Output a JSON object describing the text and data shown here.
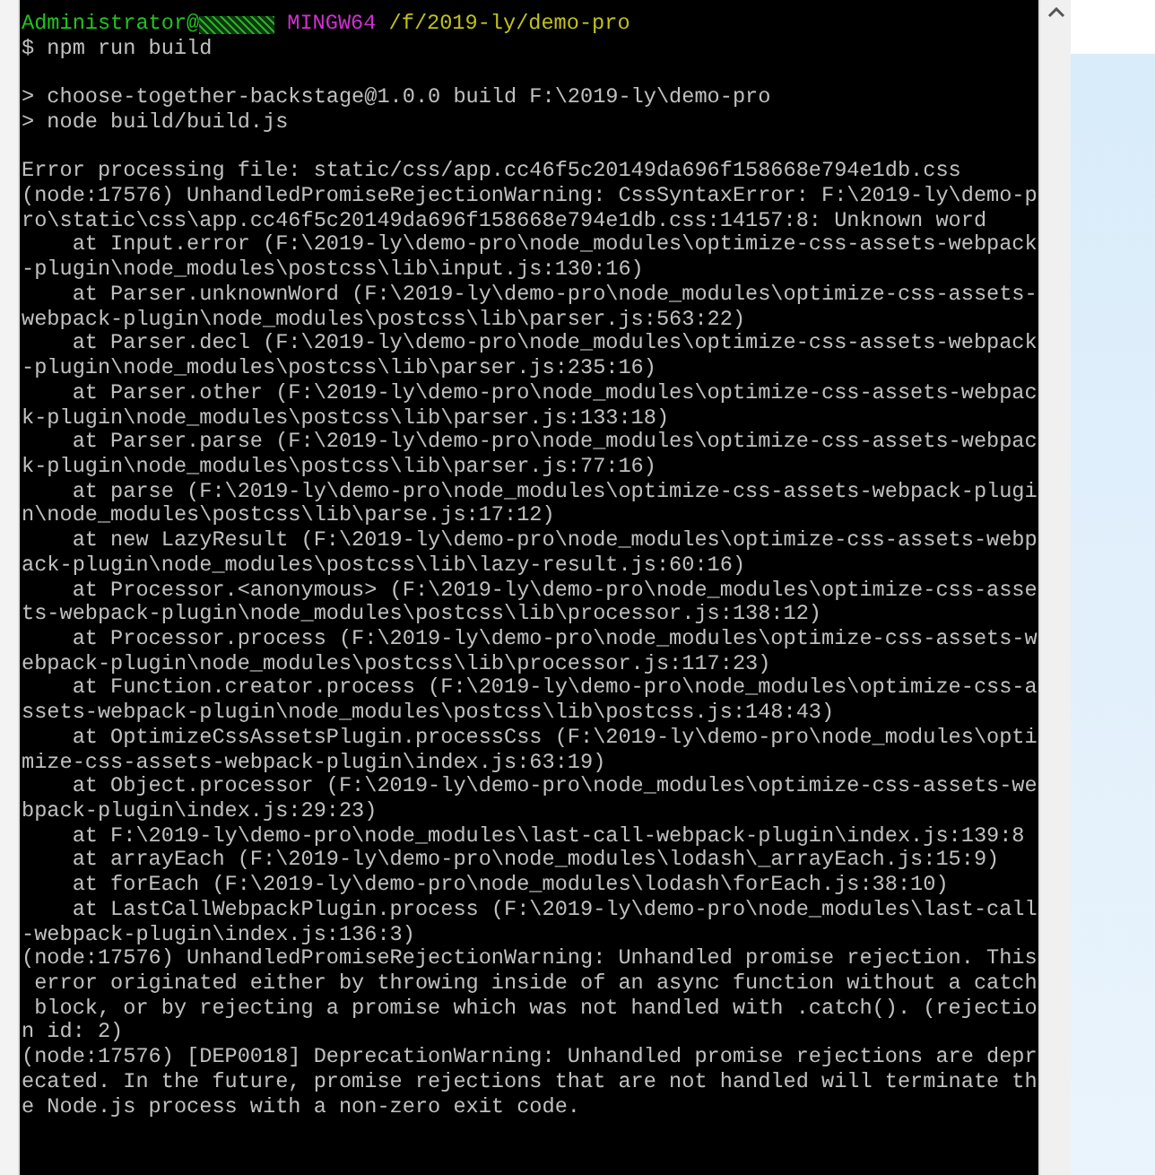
{
  "prompt": {
    "user": "Administrator@",
    "shell": "MINGW64",
    "path": "/f/2019-ly/demo-pro"
  },
  "command": "$ npm run build",
  "output_blocks": [
    [
      "> choose-together-backstage@1.0.0 build F:\\2019-ly\\demo-pro",
      "> node build/build.js"
    ],
    [
      "Error processing file: static/css/app.cc46f5c20149da696f158668e794e1db.css",
      "(node:17576) UnhandledPromiseRejectionWarning: CssSyntaxError: F:\\2019-ly\\demo-p",
      "ro\\static\\css\\app.cc46f5c20149da696f158668e794e1db.css:14157:8: Unknown word",
      "    at Input.error (F:\\2019-ly\\demo-pro\\node_modules\\optimize-css-assets-webpack",
      "-plugin\\node_modules\\postcss\\lib\\input.js:130:16)",
      "    at Parser.unknownWord (F:\\2019-ly\\demo-pro\\node_modules\\optimize-css-assets-",
      "webpack-plugin\\node_modules\\postcss\\lib\\parser.js:563:22)",
      "    at Parser.decl (F:\\2019-ly\\demo-pro\\node_modules\\optimize-css-assets-webpack",
      "-plugin\\node_modules\\postcss\\lib\\parser.js:235:16)",
      "    at Parser.other (F:\\2019-ly\\demo-pro\\node_modules\\optimize-css-assets-webpac",
      "k-plugin\\node_modules\\postcss\\lib\\parser.js:133:18)",
      "    at Parser.parse (F:\\2019-ly\\demo-pro\\node_modules\\optimize-css-assets-webpac",
      "k-plugin\\node_modules\\postcss\\lib\\parser.js:77:16)",
      "    at parse (F:\\2019-ly\\demo-pro\\node_modules\\optimize-css-assets-webpack-plugi",
      "n\\node_modules\\postcss\\lib\\parse.js:17:12)",
      "    at new LazyResult (F:\\2019-ly\\demo-pro\\node_modules\\optimize-css-assets-webp",
      "ack-plugin\\node_modules\\postcss\\lib\\lazy-result.js:60:16)",
      "    at Processor.<anonymous> (F:\\2019-ly\\demo-pro\\node_modules\\optimize-css-asse",
      "ts-webpack-plugin\\node_modules\\postcss\\lib\\processor.js:138:12)",
      "    at Processor.process (F:\\2019-ly\\demo-pro\\node_modules\\optimize-css-assets-w",
      "ebpack-plugin\\node_modules\\postcss\\lib\\processor.js:117:23)",
      "    at Function.creator.process (F:\\2019-ly\\demo-pro\\node_modules\\optimize-css-a",
      "ssets-webpack-plugin\\node_modules\\postcss\\lib\\postcss.js:148:43)",
      "    at OptimizeCssAssetsPlugin.processCss (F:\\2019-ly\\demo-pro\\node_modules\\opti",
      "mize-css-assets-webpack-plugin\\index.js:63:19)",
      "    at Object.processor (F:\\2019-ly\\demo-pro\\node_modules\\optimize-css-assets-we",
      "bpack-plugin\\index.js:29:23)",
      "    at F:\\2019-ly\\demo-pro\\node_modules\\last-call-webpack-plugin\\index.js:139:8",
      "    at arrayEach (F:\\2019-ly\\demo-pro\\node_modules\\lodash\\_arrayEach.js:15:9)",
      "    at forEach (F:\\2019-ly\\demo-pro\\node_modules\\lodash\\forEach.js:38:10)",
      "    at LastCallWebpackPlugin.process (F:\\2019-ly\\demo-pro\\node_modules\\last-call",
      "-webpack-plugin\\index.js:136:3)",
      "(node:17576) UnhandledPromiseRejectionWarning: Unhandled promise rejection. This",
      " error originated either by throwing inside of an async function without a catch",
      " block, or by rejecting a promise which was not handled with .catch(). (rejectio",
      "n id: 2)",
      "(node:17576) [DEP0018] DeprecationWarning: Unhandled promise rejections are depr",
      "ecated. In the future, promise rejections that are not handled will terminate th",
      "e Node.js process with a non-zero exit code."
    ]
  ]
}
